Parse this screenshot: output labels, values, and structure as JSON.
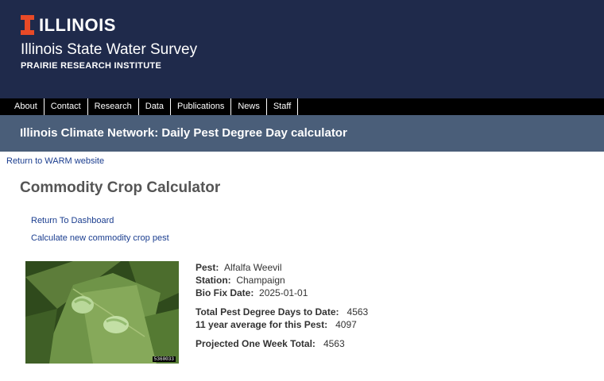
{
  "header": {
    "brand": "ILLINOIS",
    "survey": "Illinois State Water Survey",
    "institute": "PRAIRIE RESEARCH INSTITUTE"
  },
  "nav": [
    "About",
    "Contact",
    "Research",
    "Data",
    "Publications",
    "News",
    "Staff"
  ],
  "page_title_bar": "Illinois Climate Network: Daily Pest Degree Day calculator",
  "links": {
    "return_warm": "Return to WARM website",
    "return_dashboard": "Return To Dashboard",
    "new_calc": "Calculate new commodity crop pest"
  },
  "heading": "Commodity Crop Calculator",
  "image": {
    "caption": "5360033"
  },
  "result": {
    "pest_label": "Pest:",
    "pest": "Alfalfa Weevil",
    "station_label": "Station:",
    "station": "Champaign",
    "biofix_label": "Bio Fix Date:",
    "biofix": "2025-01-01",
    "total_label": "Total Pest Degree Days to Date:",
    "total": "4563",
    "avg_label": "11 year average for this Pest:",
    "avg": "4097",
    "projected_label": "Projected One Week Total:",
    "projected": "4563"
  }
}
